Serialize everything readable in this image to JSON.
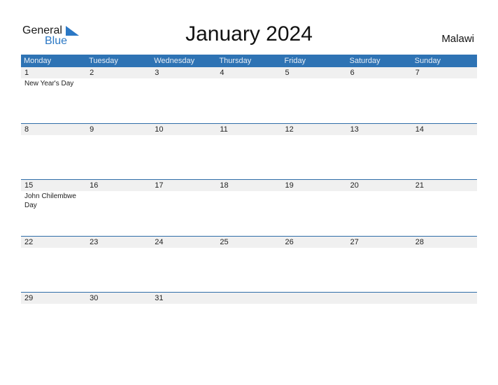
{
  "logo": {
    "line1": "General",
    "line2": "Blue"
  },
  "title": "January 2024",
  "country": "Malawi",
  "colors": {
    "header_bg": "#2e73b4",
    "accent": "#2b78c5",
    "date_row_bg": "#f0f0f0"
  },
  "weekdays": [
    "Monday",
    "Tuesday",
    "Wednesday",
    "Thursday",
    "Friday",
    "Saturday",
    "Sunday"
  ],
  "weeks": [
    {
      "days": [
        "1",
        "2",
        "3",
        "4",
        "5",
        "6",
        "7"
      ],
      "events": [
        "New Year's Day",
        "",
        "",
        "",
        "",
        "",
        ""
      ]
    },
    {
      "days": [
        "8",
        "9",
        "10",
        "11",
        "12",
        "13",
        "14"
      ],
      "events": [
        "",
        "",
        "",
        "",
        "",
        "",
        ""
      ]
    },
    {
      "days": [
        "15",
        "16",
        "17",
        "18",
        "19",
        "20",
        "21"
      ],
      "events": [
        "John Chilembwe Day",
        "",
        "",
        "",
        "",
        "",
        ""
      ]
    },
    {
      "days": [
        "22",
        "23",
        "24",
        "25",
        "26",
        "27",
        "28"
      ],
      "events": [
        "",
        "",
        "",
        "",
        "",
        "",
        ""
      ]
    },
    {
      "days": [
        "29",
        "30",
        "31",
        "",
        "",
        "",
        ""
      ],
      "events": [
        "",
        "",
        "",
        "",
        "",
        "",
        ""
      ]
    }
  ]
}
